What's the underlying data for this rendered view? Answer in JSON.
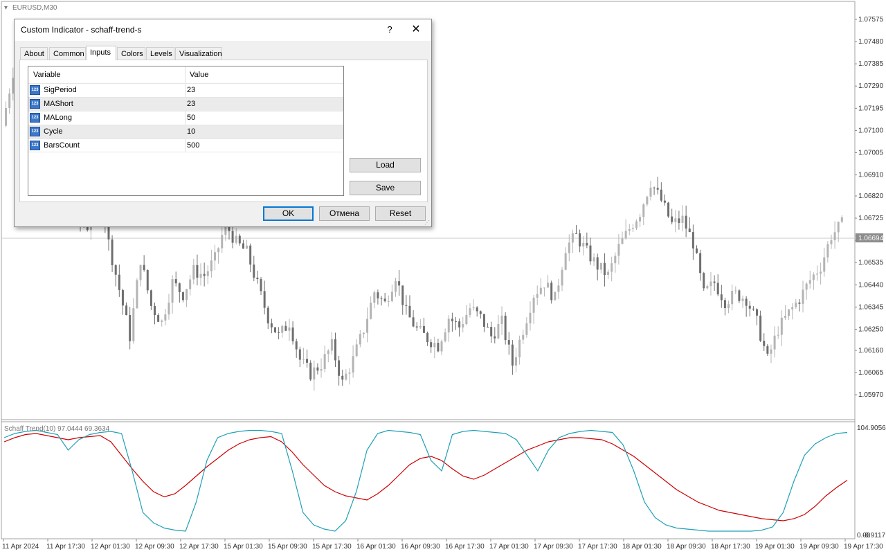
{
  "symbol_label": "EURUSD,M30",
  "indicator_label": "Schaff Trend(10) 97.0444 69.3634",
  "price_axis": [
    "1.07575",
    "1.07480",
    "1.07385",
    "1.07290",
    "1.07195",
    "1.07100",
    "1.07005",
    "1.06910",
    "1.06820",
    "1.06725",
    "1.06630",
    "1.06535",
    "1.06440",
    "1.06345",
    "1.06250",
    "1.06160",
    "1.06065",
    "1.05970"
  ],
  "current_price": "1.06694",
  "indicator_axis": {
    "top": "104.9056",
    "bottom": "-0.9117",
    "bottom_overlap": "0.00"
  },
  "time_axis": [
    "11 Apr 2024",
    "11 Apr 17:30",
    "12 Apr 01:30",
    "12 Apr 09:30",
    "12 Apr 17:30",
    "15 Apr 01:30",
    "15 Apr 09:30",
    "15 Apr 17:30",
    "16 Apr 01:30",
    "16 Apr 09:30",
    "16 Apr 17:30",
    "17 Apr 01:30",
    "17 Apr 09:30",
    "17 Apr 17:30",
    "18 Apr 01:30",
    "18 Apr 09:30",
    "18 Apr 17:30",
    "19 Apr 01:30",
    "19 Apr 09:30",
    "19 Apr 17:30"
  ],
  "colors": {
    "bull": "#b4b4b4",
    "bear": "#6e6e6e",
    "signal_line": "#cc0000",
    "trend_line": "#1ea0b4",
    "price_tag": "#8c8c8c"
  },
  "dialog": {
    "title": "Custom Indicator - schaff-trend-s",
    "help": "?",
    "close": "✕",
    "tabs": [
      "About",
      "Common",
      "Inputs",
      "Colors",
      "Levels",
      "Visualization"
    ],
    "active_tab": "Inputs",
    "columns": {
      "variable": "Variable",
      "value": "Value"
    },
    "icon_text": "123",
    "params": [
      {
        "name": "SigPeriod",
        "value": "23"
      },
      {
        "name": "MAShort",
        "value": "23"
      },
      {
        "name": "MALong",
        "value": "50"
      },
      {
        "name": "Cycle",
        "value": "10"
      },
      {
        "name": "BarsCount",
        "value": "500"
      }
    ],
    "buttons": {
      "load": "Load",
      "save": "Save",
      "ok": "OK",
      "cancel": "Отмена",
      "reset": "Reset"
    }
  },
  "chart_data": {
    "type": "candlestick",
    "price_closes": [
      1.0712,
      1.0735,
      1.0752,
      1.074,
      1.0728,
      1.0705,
      1.0684,
      1.0672,
      1.0669,
      1.069,
      1.0662,
      1.0642,
      1.0622,
      1.0655,
      1.0635,
      1.0628,
      1.0645,
      1.064,
      1.065,
      1.0648,
      1.0655,
      1.067,
      1.0662,
      1.0658,
      1.0644,
      1.063,
      1.0622,
      1.0628,
      1.0612,
      1.0606,
      1.061,
      1.0618,
      1.0602,
      1.0612,
      1.0625,
      1.0641,
      1.0636,
      1.0648,
      1.0632,
      1.0625,
      1.0621,
      1.0618,
      1.063,
      1.0626,
      1.0634,
      1.063,
      1.0622,
      1.0628,
      1.061,
      1.0625,
      1.064,
      1.0645,
      1.0638,
      1.066,
      1.0665,
      1.0658,
      1.0652,
      1.0648,
      1.066,
      1.0668,
      1.0675,
      1.0688,
      1.068,
      1.067,
      1.0672,
      1.0662,
      1.064,
      1.0645,
      1.0637,
      1.064,
      1.0638,
      1.0628,
      1.0612,
      1.0625,
      1.0632,
      1.0638,
      1.0646,
      1.0652,
      1.0665,
      1.067
    ],
    "signal_line": [
      88,
      92,
      95,
      96,
      94,
      92,
      90,
      92,
      93,
      94,
      88,
      75,
      62,
      50,
      40,
      35,
      38,
      46,
      55,
      64,
      72,
      80,
      86,
      90,
      92,
      93,
      88,
      78,
      66,
      56,
      46,
      40,
      36,
      34,
      32,
      38,
      46,
      56,
      66,
      72,
      74,
      70,
      62,
      55,
      52,
      56,
      62,
      68,
      74,
      80,
      84,
      88,
      90,
      92,
      92,
      91,
      90,
      86,
      80,
      74,
      66,
      58,
      50,
      42,
      36,
      30,
      26,
      22,
      20,
      18,
      16,
      14,
      13,
      12,
      14,
      18,
      26,
      36,
      44,
      51
    ],
    "trend_line": [
      92,
      96,
      98,
      99,
      97,
      95,
      80,
      90,
      95,
      97,
      98,
      96,
      60,
      20,
      10,
      5,
      3,
      2,
      30,
      70,
      92,
      96,
      98,
      99,
      99,
      98,
      96,
      60,
      20,
      8,
      4,
      2,
      12,
      40,
      80,
      96,
      99,
      98,
      97,
      95,
      70,
      60,
      95,
      98,
      99,
      98,
      97,
      96,
      90,
      75,
      60,
      80,
      92,
      96,
      98,
      99,
      98,
      97,
      85,
      60,
      30,
      15,
      8,
      5,
      4,
      3,
      2,
      2,
      2,
      2,
      2,
      3,
      6,
      20,
      50,
      75,
      86,
      92,
      96,
      97
    ]
  }
}
